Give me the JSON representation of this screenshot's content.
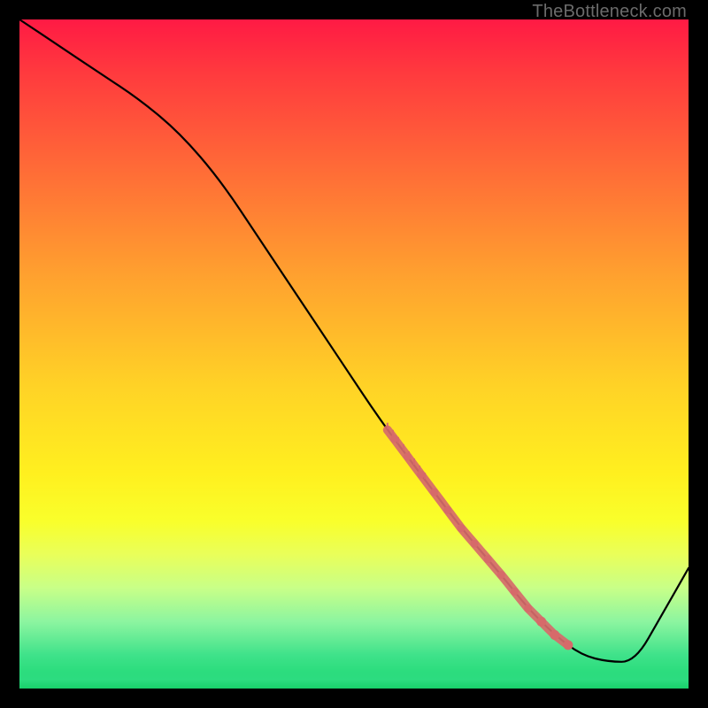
{
  "watermark": "TheBottleneck.com",
  "colors": {
    "top": "#ff1a44",
    "mid": "#ffd326",
    "bottom": "#18d86f",
    "line": "#000000",
    "marker": "#d66a6a",
    "frame": "#000000"
  },
  "chart_data": {
    "type": "line",
    "title": "",
    "xlabel": "",
    "ylabel": "",
    "xlim": [
      0,
      100
    ],
    "ylim": [
      0,
      100
    ],
    "grid": false,
    "legend": false,
    "series": [
      {
        "name": "bottleneck-curve",
        "x": [
          0,
          6,
          12,
          18,
          24,
          30,
          36,
          42,
          48,
          54,
          60,
          66,
          72,
          76,
          80,
          84,
          88,
          92,
          96,
          100
        ],
        "y": [
          100,
          96,
          92,
          88,
          83,
          76,
          67,
          58,
          49,
          40,
          32,
          24,
          17,
          12,
          8,
          5,
          4,
          4,
          11,
          18
        ]
      }
    ],
    "highlight_region": {
      "x_start": 55,
      "x_end": 82
    },
    "highlight_markers_x": [
      56,
      58,
      60,
      62,
      64,
      66,
      68,
      70,
      72,
      74,
      76,
      78,
      80,
      82
    ]
  }
}
